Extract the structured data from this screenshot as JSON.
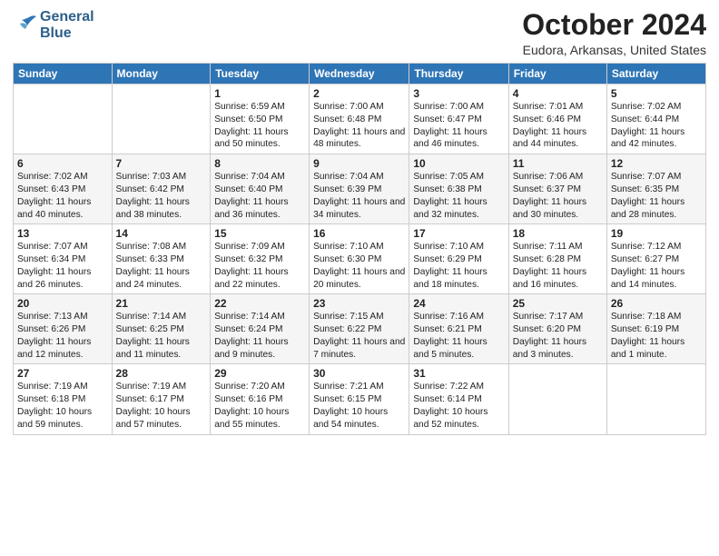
{
  "header": {
    "logo_line1": "General",
    "logo_line2": "Blue",
    "title": "October 2024",
    "location": "Eudora, Arkansas, United States"
  },
  "days_of_week": [
    "Sunday",
    "Monday",
    "Tuesday",
    "Wednesday",
    "Thursday",
    "Friday",
    "Saturday"
  ],
  "weeks": [
    [
      {
        "day": "",
        "info": ""
      },
      {
        "day": "",
        "info": ""
      },
      {
        "day": "1",
        "info": "Sunrise: 6:59 AM\nSunset: 6:50 PM\nDaylight: 11 hours and 50 minutes."
      },
      {
        "day": "2",
        "info": "Sunrise: 7:00 AM\nSunset: 6:48 PM\nDaylight: 11 hours and 48 minutes."
      },
      {
        "day": "3",
        "info": "Sunrise: 7:00 AM\nSunset: 6:47 PM\nDaylight: 11 hours and 46 minutes."
      },
      {
        "day": "4",
        "info": "Sunrise: 7:01 AM\nSunset: 6:46 PM\nDaylight: 11 hours and 44 minutes."
      },
      {
        "day": "5",
        "info": "Sunrise: 7:02 AM\nSunset: 6:44 PM\nDaylight: 11 hours and 42 minutes."
      }
    ],
    [
      {
        "day": "6",
        "info": "Sunrise: 7:02 AM\nSunset: 6:43 PM\nDaylight: 11 hours and 40 minutes."
      },
      {
        "day": "7",
        "info": "Sunrise: 7:03 AM\nSunset: 6:42 PM\nDaylight: 11 hours and 38 minutes."
      },
      {
        "day": "8",
        "info": "Sunrise: 7:04 AM\nSunset: 6:40 PM\nDaylight: 11 hours and 36 minutes."
      },
      {
        "day": "9",
        "info": "Sunrise: 7:04 AM\nSunset: 6:39 PM\nDaylight: 11 hours and 34 minutes."
      },
      {
        "day": "10",
        "info": "Sunrise: 7:05 AM\nSunset: 6:38 PM\nDaylight: 11 hours and 32 minutes."
      },
      {
        "day": "11",
        "info": "Sunrise: 7:06 AM\nSunset: 6:37 PM\nDaylight: 11 hours and 30 minutes."
      },
      {
        "day": "12",
        "info": "Sunrise: 7:07 AM\nSunset: 6:35 PM\nDaylight: 11 hours and 28 minutes."
      }
    ],
    [
      {
        "day": "13",
        "info": "Sunrise: 7:07 AM\nSunset: 6:34 PM\nDaylight: 11 hours and 26 minutes."
      },
      {
        "day": "14",
        "info": "Sunrise: 7:08 AM\nSunset: 6:33 PM\nDaylight: 11 hours and 24 minutes."
      },
      {
        "day": "15",
        "info": "Sunrise: 7:09 AM\nSunset: 6:32 PM\nDaylight: 11 hours and 22 minutes."
      },
      {
        "day": "16",
        "info": "Sunrise: 7:10 AM\nSunset: 6:30 PM\nDaylight: 11 hours and 20 minutes."
      },
      {
        "day": "17",
        "info": "Sunrise: 7:10 AM\nSunset: 6:29 PM\nDaylight: 11 hours and 18 minutes."
      },
      {
        "day": "18",
        "info": "Sunrise: 7:11 AM\nSunset: 6:28 PM\nDaylight: 11 hours and 16 minutes."
      },
      {
        "day": "19",
        "info": "Sunrise: 7:12 AM\nSunset: 6:27 PM\nDaylight: 11 hours and 14 minutes."
      }
    ],
    [
      {
        "day": "20",
        "info": "Sunrise: 7:13 AM\nSunset: 6:26 PM\nDaylight: 11 hours and 12 minutes."
      },
      {
        "day": "21",
        "info": "Sunrise: 7:14 AM\nSunset: 6:25 PM\nDaylight: 11 hours and 11 minutes."
      },
      {
        "day": "22",
        "info": "Sunrise: 7:14 AM\nSunset: 6:24 PM\nDaylight: 11 hours and 9 minutes."
      },
      {
        "day": "23",
        "info": "Sunrise: 7:15 AM\nSunset: 6:22 PM\nDaylight: 11 hours and 7 minutes."
      },
      {
        "day": "24",
        "info": "Sunrise: 7:16 AM\nSunset: 6:21 PM\nDaylight: 11 hours and 5 minutes."
      },
      {
        "day": "25",
        "info": "Sunrise: 7:17 AM\nSunset: 6:20 PM\nDaylight: 11 hours and 3 minutes."
      },
      {
        "day": "26",
        "info": "Sunrise: 7:18 AM\nSunset: 6:19 PM\nDaylight: 11 hours and 1 minute."
      }
    ],
    [
      {
        "day": "27",
        "info": "Sunrise: 7:19 AM\nSunset: 6:18 PM\nDaylight: 10 hours and 59 minutes."
      },
      {
        "day": "28",
        "info": "Sunrise: 7:19 AM\nSunset: 6:17 PM\nDaylight: 10 hours and 57 minutes."
      },
      {
        "day": "29",
        "info": "Sunrise: 7:20 AM\nSunset: 6:16 PM\nDaylight: 10 hours and 55 minutes."
      },
      {
        "day": "30",
        "info": "Sunrise: 7:21 AM\nSunset: 6:15 PM\nDaylight: 10 hours and 54 minutes."
      },
      {
        "day": "31",
        "info": "Sunrise: 7:22 AM\nSunset: 6:14 PM\nDaylight: 10 hours and 52 minutes."
      },
      {
        "day": "",
        "info": ""
      },
      {
        "day": "",
        "info": ""
      }
    ]
  ]
}
